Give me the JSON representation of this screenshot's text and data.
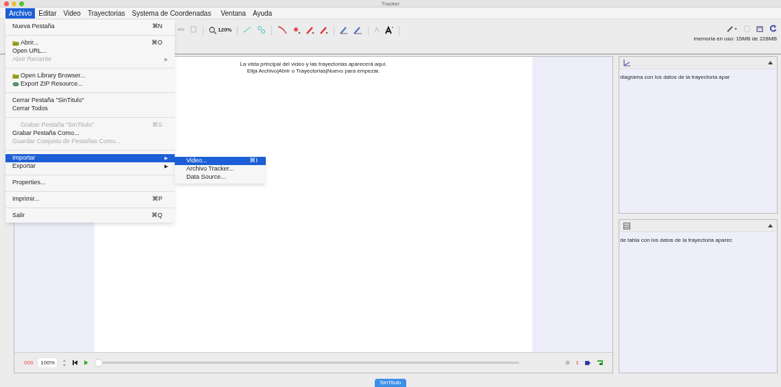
{
  "window": {
    "title": "Tracker"
  },
  "menubar": [
    {
      "label": "Archivo",
      "selected": true
    },
    {
      "label": "Editar",
      "selected": false
    },
    {
      "label": "Video",
      "selected": false
    },
    {
      "label": "Trayectorias",
      "selected": false
    },
    {
      "label": "Systema de Coordenadas",
      "selected": false
    },
    {
      "label": "Ventana",
      "selected": false
    },
    {
      "label": "Ayuda",
      "selected": false
    }
  ],
  "toolbar": {
    "zoom": "120%",
    "memory": "memoria en uso: 15MB de 228MB"
  },
  "menu": [
    {
      "kind": "item",
      "label": "Nueva Pestaña",
      "shortcut": "⌘N",
      "disabled": false,
      "selected": false
    },
    {
      "kind": "separator"
    },
    {
      "kind": "folder-item",
      "label": "Abrir...",
      "shortcut": "⌘O",
      "disabled": false,
      "selected": false
    },
    {
      "kind": "item",
      "label": "Open URL...",
      "disabled": false,
      "selected": false
    },
    {
      "kind": "item",
      "label": "Abrir Reciente",
      "arrow": "▶",
      "disabled": true,
      "selected": false
    },
    {
      "kind": "separator"
    },
    {
      "kind": "folder-item",
      "label": "Open Library Browser...",
      "disabled": false,
      "selected": false
    },
    {
      "kind": "zip-item",
      "label": "Export ZIP Resource...",
      "disabled": false,
      "selected": false
    },
    {
      "kind": "separator"
    },
    {
      "kind": "item",
      "label": "Cerrar Pestaña \"SinTitulo\"",
      "disabled": false,
      "selected": false
    },
    {
      "kind": "item",
      "label": "Cerrar Todos",
      "disabled": false,
      "selected": false
    },
    {
      "kind": "separator"
    },
    {
      "kind": "item",
      "label": "Grabar Pestaña \"SinTitulo\"",
      "shortcut": "⌘S",
      "disabled": true,
      "selected": false
    },
    {
      "kind": "item",
      "label": "Grabar Pestaña Como...",
      "disabled": false,
      "selected": false
    },
    {
      "kind": "item",
      "label": "Guardar Conjunto de Pestañas Como...",
      "disabled": true,
      "selected": false
    },
    {
      "kind": "separator"
    },
    {
      "kind": "item",
      "label": "Importar",
      "arrow": "▶",
      "disabled": false,
      "selected": true
    },
    {
      "kind": "item",
      "label": "Exportar",
      "arrow": "▶",
      "disabled": false,
      "selected": false
    },
    {
      "kind": "separator"
    },
    {
      "kind": "item",
      "label": "Properties...",
      "disabled": false,
      "selected": false
    },
    {
      "kind": "separator"
    },
    {
      "kind": "item",
      "label": "Imprimir...",
      "shortcut": "⌘P",
      "disabled": false,
      "selected": false
    },
    {
      "kind": "separator"
    },
    {
      "kind": "item",
      "label": "Salir",
      "shortcut": "⌘Q",
      "disabled": false,
      "selected": false
    }
  ],
  "submenu": [
    {
      "label": "Video...",
      "shortcut": "⌘I",
      "selected": true
    },
    {
      "label": "Archivo Tracker...",
      "selected": false
    },
    {
      "label": "Data Source...",
      "selected": false
    }
  ],
  "video_view": {
    "message": [
      "La vista principal del video y las trayectorias aparecerá aquí.",
      "Elija Archivo|Abrir o Trayectorias|Nuevo para empezar."
    ]
  },
  "player": {
    "frame": "000",
    "rate": "100%",
    "slider": {
      "level": 0
    },
    "step": "1"
  },
  "plot_panel": {
    "message": "diagrama con los datos de la trayectoria apar"
  },
  "table_panel": {
    "message": "de tabla con los datos de la trayectoria aparec"
  },
  "tabs": [
    {
      "label": "SinTitulo",
      "selected": true
    }
  ]
}
